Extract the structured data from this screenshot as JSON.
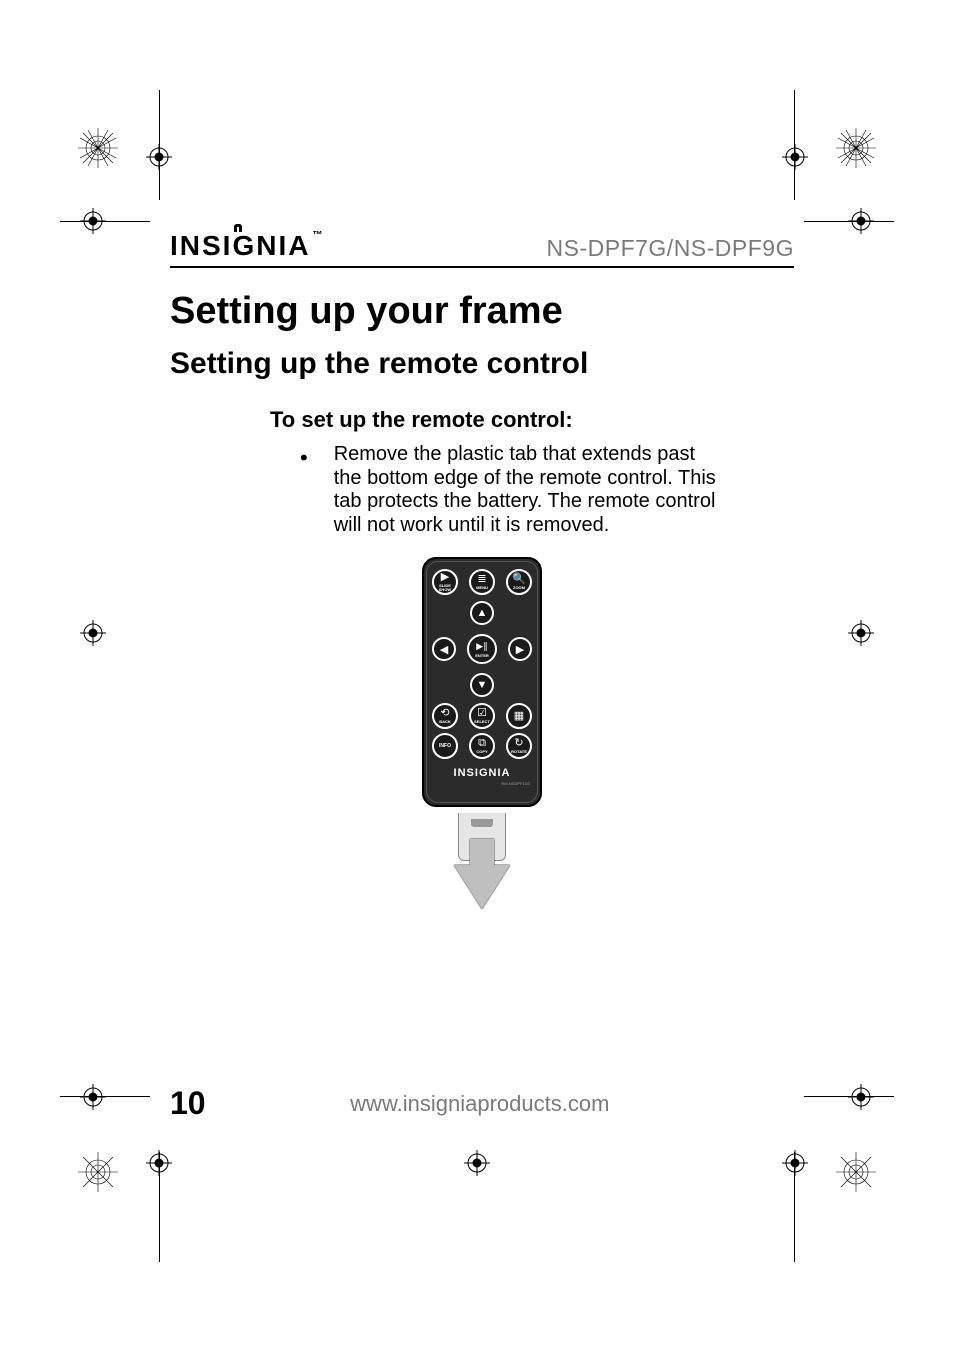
{
  "header": {
    "brand": "INSIGNIA",
    "trademark": "™",
    "model": "NS-DPF7G/NS-DPF9G"
  },
  "title": "Setting up your frame",
  "subtitle": "Setting up the remote control",
  "step_heading": "To set up the remote control:",
  "bullet": "Remove the plastic tab that extends past the bottom edge of the remote control. This tab protects the battery. The remote control will not work until it is removed.",
  "remote": {
    "row1": {
      "slideshow": {
        "icon": "▶",
        "label": "SLIDE\nSHOW"
      },
      "menu": {
        "icon": "≣",
        "label": "MENU"
      },
      "zoom": {
        "icon": "🔍",
        "label": "ZOOM"
      }
    },
    "dpad": {
      "up": "▲",
      "down": "▼",
      "left": "◀",
      "right": "▶",
      "center_icon": "▶∥",
      "center_label": "ENTER"
    },
    "row2": {
      "back": {
        "icon": "⟲",
        "label": "BACK"
      },
      "select": {
        "icon": "☑",
        "label": "SELECT"
      },
      "cal": {
        "icon": "▦",
        "label": ""
      }
    },
    "row3": {
      "info": {
        "icon": "",
        "label": "INFO"
      },
      "copy": {
        "icon": "⧉",
        "label": "COPY"
      },
      "rotate": {
        "icon": "↻",
        "label": "ROTATE"
      }
    },
    "brand": "INSIGNIA",
    "model_small": "RM-NSDPF10G"
  },
  "footer": {
    "page": "10",
    "site": "www.insigniaproducts.com"
  }
}
